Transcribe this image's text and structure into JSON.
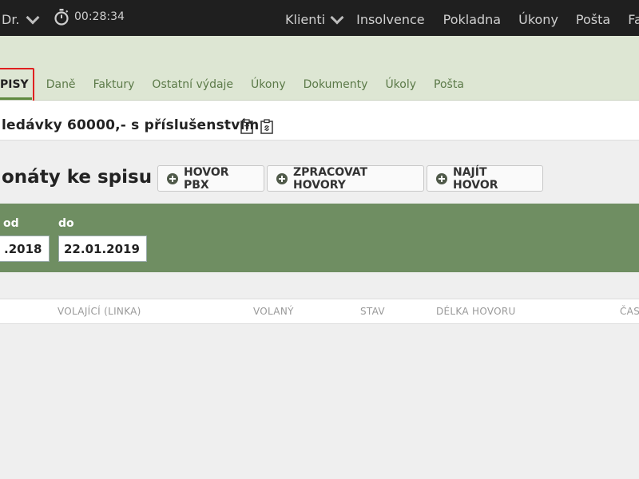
{
  "topbar": {
    "user_label": "Dr.",
    "timer": "00:28:34",
    "nav": [
      "Klienti",
      "Insolvence",
      "Pokladna",
      "Úkony",
      "Pošta",
      "Fakt"
    ]
  },
  "tabs": [
    "PISY",
    "Daně",
    "Faktury",
    "Ostatní výdaje",
    "Úkony",
    "Dokumenty",
    "Úkoly",
    "Pošta"
  ],
  "case": {
    "title": "ledávky 60000,- s příslušenstvím"
  },
  "section": {
    "title": "onáty ke spisu",
    "buttons": [
      "HOVOR PBX",
      "ZPRACOVAT HOVORY",
      "NAJÍT HOVOR"
    ]
  },
  "filter": {
    "from_label": "od",
    "from_value": ".2018",
    "to_label": "do",
    "to_value": "22.01.2019"
  },
  "table": {
    "columns": [
      "VOLAJÍCÍ (LINKA)",
      "VOLANÝ",
      "STAV",
      "DÉLKA HOVORU",
      "ČAS"
    ]
  },
  "colors": {
    "topbar": "#1f1f1f",
    "tabstrip": "#dde6d3",
    "filterband": "#6f8e62",
    "accent": "#5f8a3f",
    "highlight": "#e02020"
  }
}
